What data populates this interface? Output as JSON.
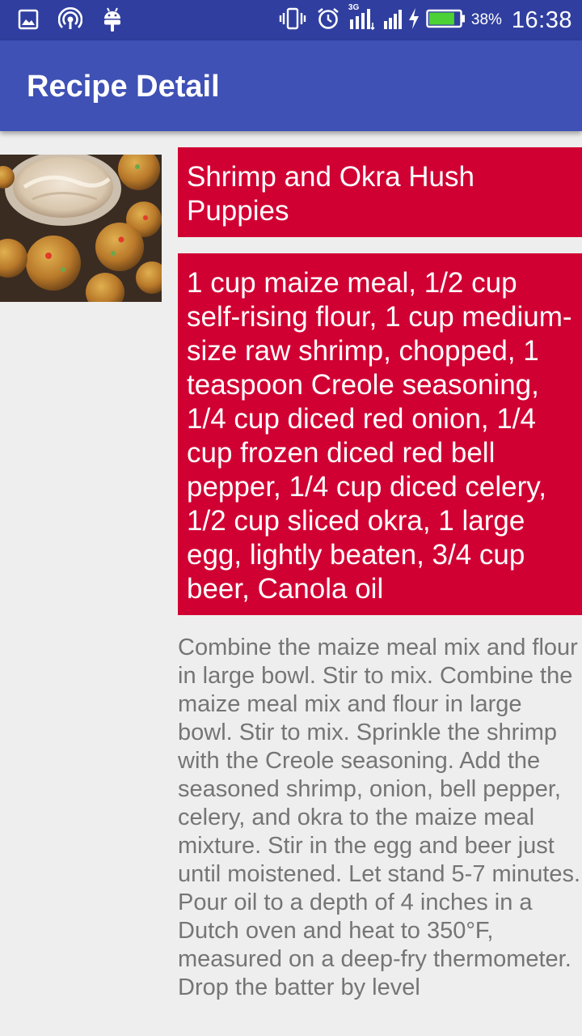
{
  "status_bar": {
    "background": "#303f9f",
    "left_icons": [
      "image-icon",
      "hotspot-icon",
      "android-icon"
    ],
    "right_icons": [
      "vibrate-icon",
      "alarm-icon",
      "signal-3g-icon",
      "signal-icon",
      "charging-icon",
      "battery-icon"
    ],
    "network_type": "3G",
    "battery_percent": "38%",
    "battery_level": 0.38,
    "time": "16:38"
  },
  "app_bar": {
    "title": "Recipe Detail",
    "background": "#3f51b5"
  },
  "recipe": {
    "image_icon": "hush-puppies-photo",
    "title": "Shrimp and Okra Hush Puppies",
    "ingredients": "1  cup maize meal, 1/2  cup self-rising flour, 1  cup medium-size raw shrimp, chopped, 1  teaspoon Creole seasoning, 1/4  cup diced red onion, 1/4  cup frozen diced red bell pepper, 1/4  cup diced celery, 1/2  cup sliced okra, 1 large egg, lightly beaten, 3/4 cup beer, Canola oil",
    "directions": "Combine the maize meal mix and flour in large bowl. Stir to mix. Combine the maize meal mix and flour in large bowl. Stir to mix. Sprinkle the shrimp with the Creole seasoning. Add the seasoned shrimp, onion, bell pepper, celery, and okra to the maize meal mixture. Stir in the egg and beer just until moistened. Let stand 5-7 minutes. Pour oil to a depth of 4 inches in a Dutch oven and heat to 350°F, measured on a deep-fry thermometer. Drop the batter by level",
    "accent_color": "#d10033",
    "body_text_color": "#757575"
  }
}
